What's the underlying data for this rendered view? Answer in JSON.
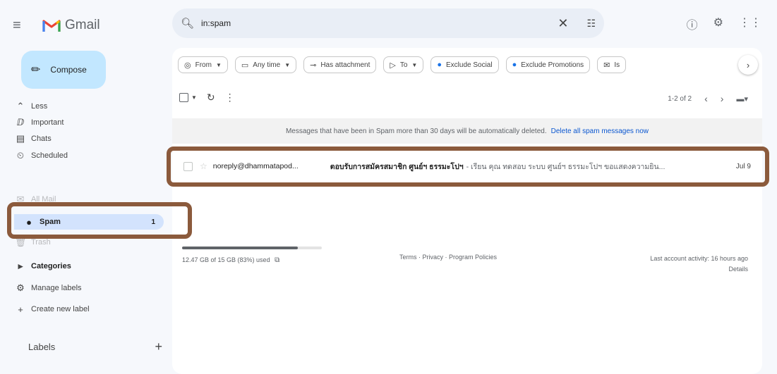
{
  "app": {
    "name": "Gmail"
  },
  "search": {
    "query": "in:spam"
  },
  "compose": {
    "label": "Compose"
  },
  "sidebar": {
    "items": [
      {
        "label": "Less",
        "icon": "chevron-up-icon",
        "glyph": "⌃"
      },
      {
        "label": "Important",
        "icon": "important-icon",
        "glyph": "ⅅ"
      },
      {
        "label": "Chats",
        "icon": "chat-icon",
        "glyph": "▤"
      },
      {
        "label": "Scheduled",
        "icon": "scheduled-icon",
        "glyph": "⏲"
      },
      {
        "label": "All Mail",
        "icon": "all-mail-icon",
        "glyph": "✉"
      },
      {
        "label": "Spam",
        "icon": "spam-icon",
        "glyph": "●",
        "count": "1"
      },
      {
        "label": "Trash",
        "icon": "trash-icon",
        "glyph": "🗑"
      },
      {
        "label": "Categories",
        "icon": "categories-icon",
        "glyph": "▸"
      },
      {
        "label": "Manage labels",
        "icon": "gear-icon",
        "glyph": "⚙"
      },
      {
        "label": "Create new label",
        "icon": "plus-icon",
        "glyph": "+"
      }
    ],
    "labels_heading": "Labels"
  },
  "filters": {
    "chips": [
      {
        "label": "From",
        "icon": "person-icon",
        "glyph": "◎",
        "dropdown": true
      },
      {
        "label": "Any time",
        "icon": "calendar-icon",
        "glyph": "▭",
        "dropdown": true
      },
      {
        "label": "Has attachment",
        "icon": "attachment-icon",
        "glyph": "⊸",
        "dropdown": false
      },
      {
        "label": "To",
        "icon": "send-icon",
        "glyph": "▷",
        "dropdown": true
      },
      {
        "label": "Exclude Social",
        "icon": "social-icon",
        "glyph": "●",
        "dropdown": false
      },
      {
        "label": "Exclude Promotions",
        "icon": "promotions-icon",
        "glyph": "●",
        "dropdown": false
      },
      {
        "label": "Is",
        "icon": "mail-icon",
        "glyph": "✉",
        "dropdown": false
      }
    ]
  },
  "pager": {
    "range": "1-2 of 2"
  },
  "banner": {
    "text": "Messages that have been in Spam more than 30 days will be automatically deleted.",
    "link": "Delete all spam messages now"
  },
  "messages": [
    {
      "sender": "noreply@dhammatapod...",
      "subject": "ตอบรับการสมัครสมาชิก ศูนย์ฯ ธรรมะโปฯ",
      "snippet": "- เรียน คุณ ทดสอบ ระบบ ศูนย์ฯ ธรรมะโปฯ ขอแสดงความยิน...",
      "date": "Jul 9"
    }
  ],
  "storage": {
    "text": "12.47 GB of 15 GB (83%) used",
    "percent": 83
  },
  "footer": {
    "links": "Terms · Privacy · Program Policies",
    "activity": "Last account activity: 16 hours ago",
    "details": "Details"
  },
  "colors": {
    "highlight": "#8b5a3c",
    "compose_bg": "#c2e7ff",
    "link": "#0b57d0"
  }
}
